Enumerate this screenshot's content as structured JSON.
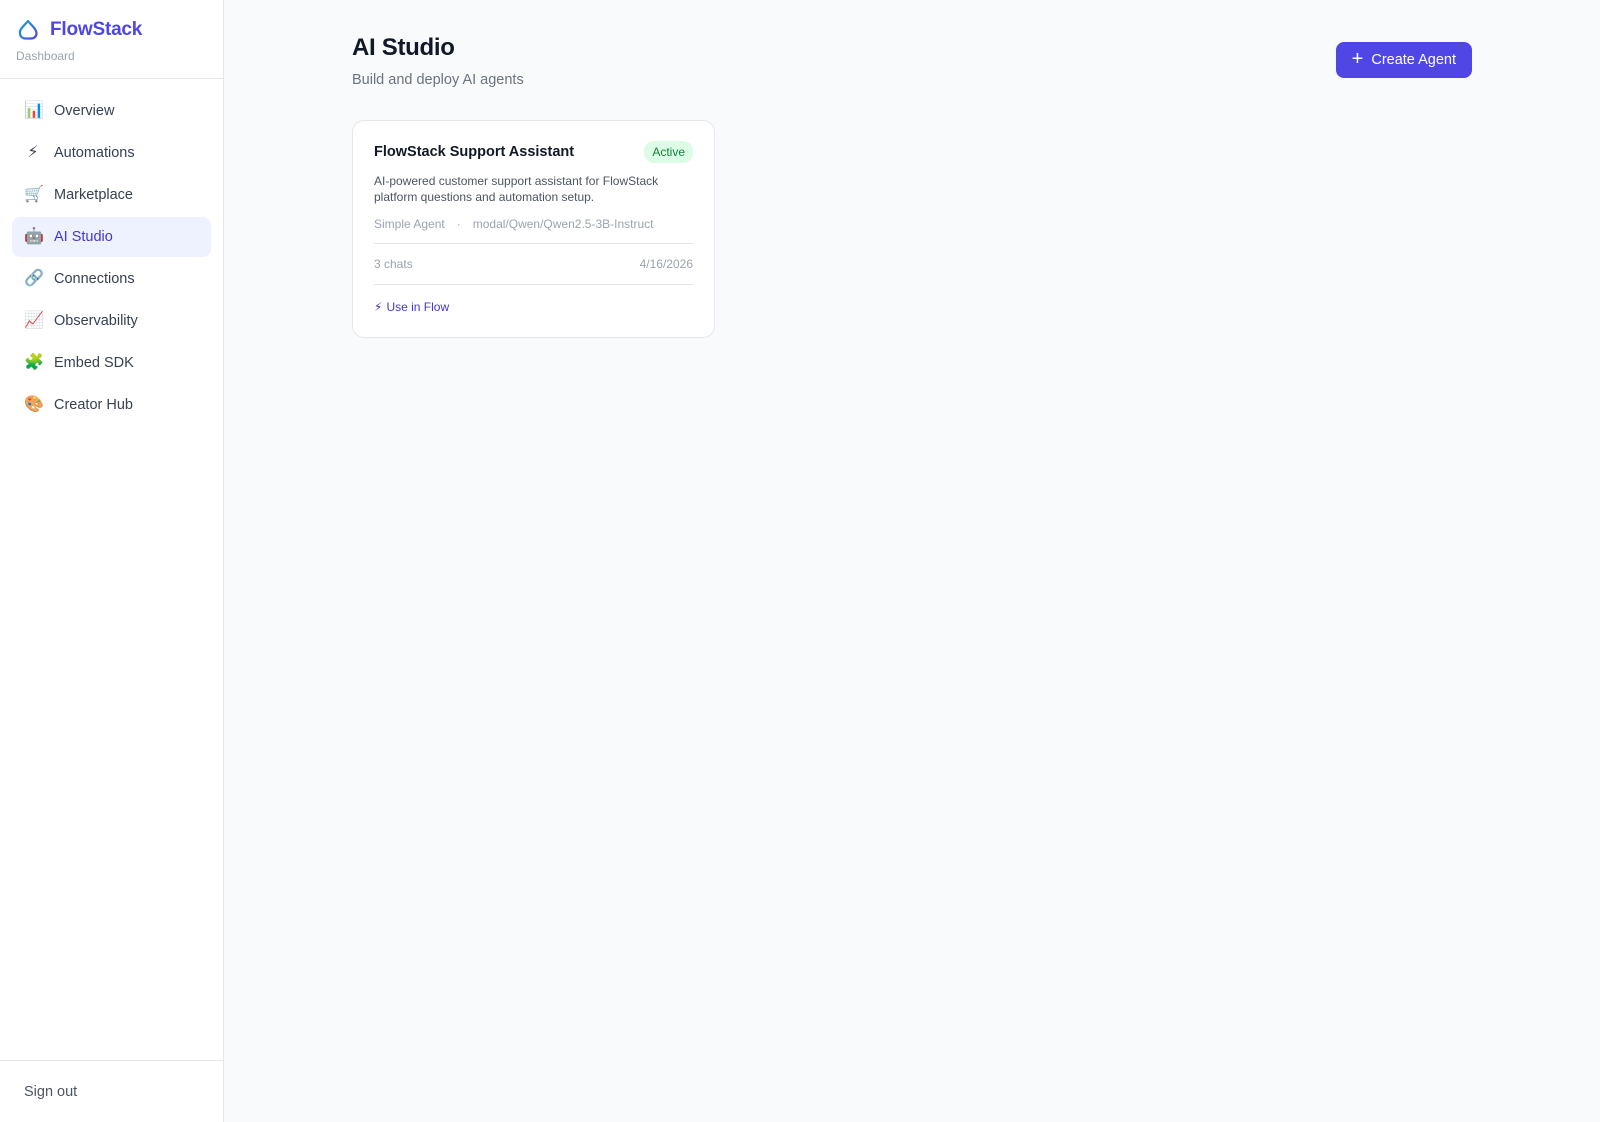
{
  "brand": {
    "name": "FlowStack",
    "subtitle": "Dashboard",
    "logo_icon": "cloud-icon",
    "accent": "#4f46e5"
  },
  "sidebar": {
    "items": [
      {
        "label": "Overview",
        "icon": "📊",
        "icon_name": "bar-chart-icon"
      },
      {
        "label": "Automations",
        "icon": "⚡",
        "icon_name": "lightning-icon"
      },
      {
        "label": "Marketplace",
        "icon": "🛒",
        "icon_name": "cart-icon"
      },
      {
        "label": "AI Studio",
        "icon": "🤖",
        "icon_name": "robot-icon",
        "active": true
      },
      {
        "label": "Connections",
        "icon": "🔗",
        "icon_name": "link-icon"
      },
      {
        "label": "Observability",
        "icon": "📈",
        "icon_name": "trend-chart-icon"
      },
      {
        "label": "Embed SDK",
        "icon": "🧩",
        "icon_name": "puzzle-icon"
      },
      {
        "label": "Creator Hub",
        "icon": "🎨",
        "icon_name": "palette-icon"
      }
    ],
    "signout": "Sign out"
  },
  "header": {
    "title": "AI Studio",
    "subtitle": "Build and deploy AI agents",
    "create_label": "Create Agent"
  },
  "agents": [
    {
      "name": "FlowStack Support Assistant",
      "status": "Active",
      "description": "AI-powered customer support assistant for FlowStack platform questions and automation setup.",
      "type": "Simple Agent",
      "separator": "·",
      "model": "modal/Qwen/Qwen2.5-3B-Instruct",
      "chats": "3 chats",
      "date": "4/16/2026",
      "action_icon": "⚡",
      "action_label": "Use in Flow"
    }
  ]
}
